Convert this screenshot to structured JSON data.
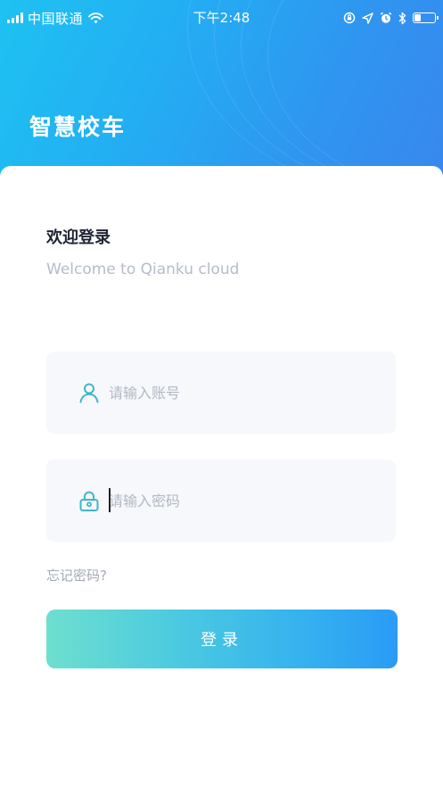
{
  "status_bar": {
    "carrier": "中国联通",
    "time": "下午2:48",
    "battery_level": 0.35
  },
  "header": {
    "app_title": "智慧校车"
  },
  "login": {
    "title": "欢迎登录",
    "subtitle": "Welcome to Qianku cloud",
    "account_placeholder": "请输入账号",
    "password_placeholder": "请输入密码",
    "forgot_password": "忘记密码?",
    "submit_label": "登录"
  },
  "colors": {
    "header_gradient_start": "#1ec2f2",
    "header_gradient_end": "#3a86ee",
    "button_gradient_start": "#6edfcf",
    "button_gradient_end": "#2a9bf6",
    "icon_accent": "#3fb6c9"
  },
  "icons": {
    "user_field": "user-icon",
    "password_field": "lock-icon",
    "status": [
      "signal-icon",
      "wifi-icon",
      "screen-lock-icon",
      "location-icon",
      "alarm-icon",
      "bluetooth-icon",
      "battery-icon"
    ]
  }
}
